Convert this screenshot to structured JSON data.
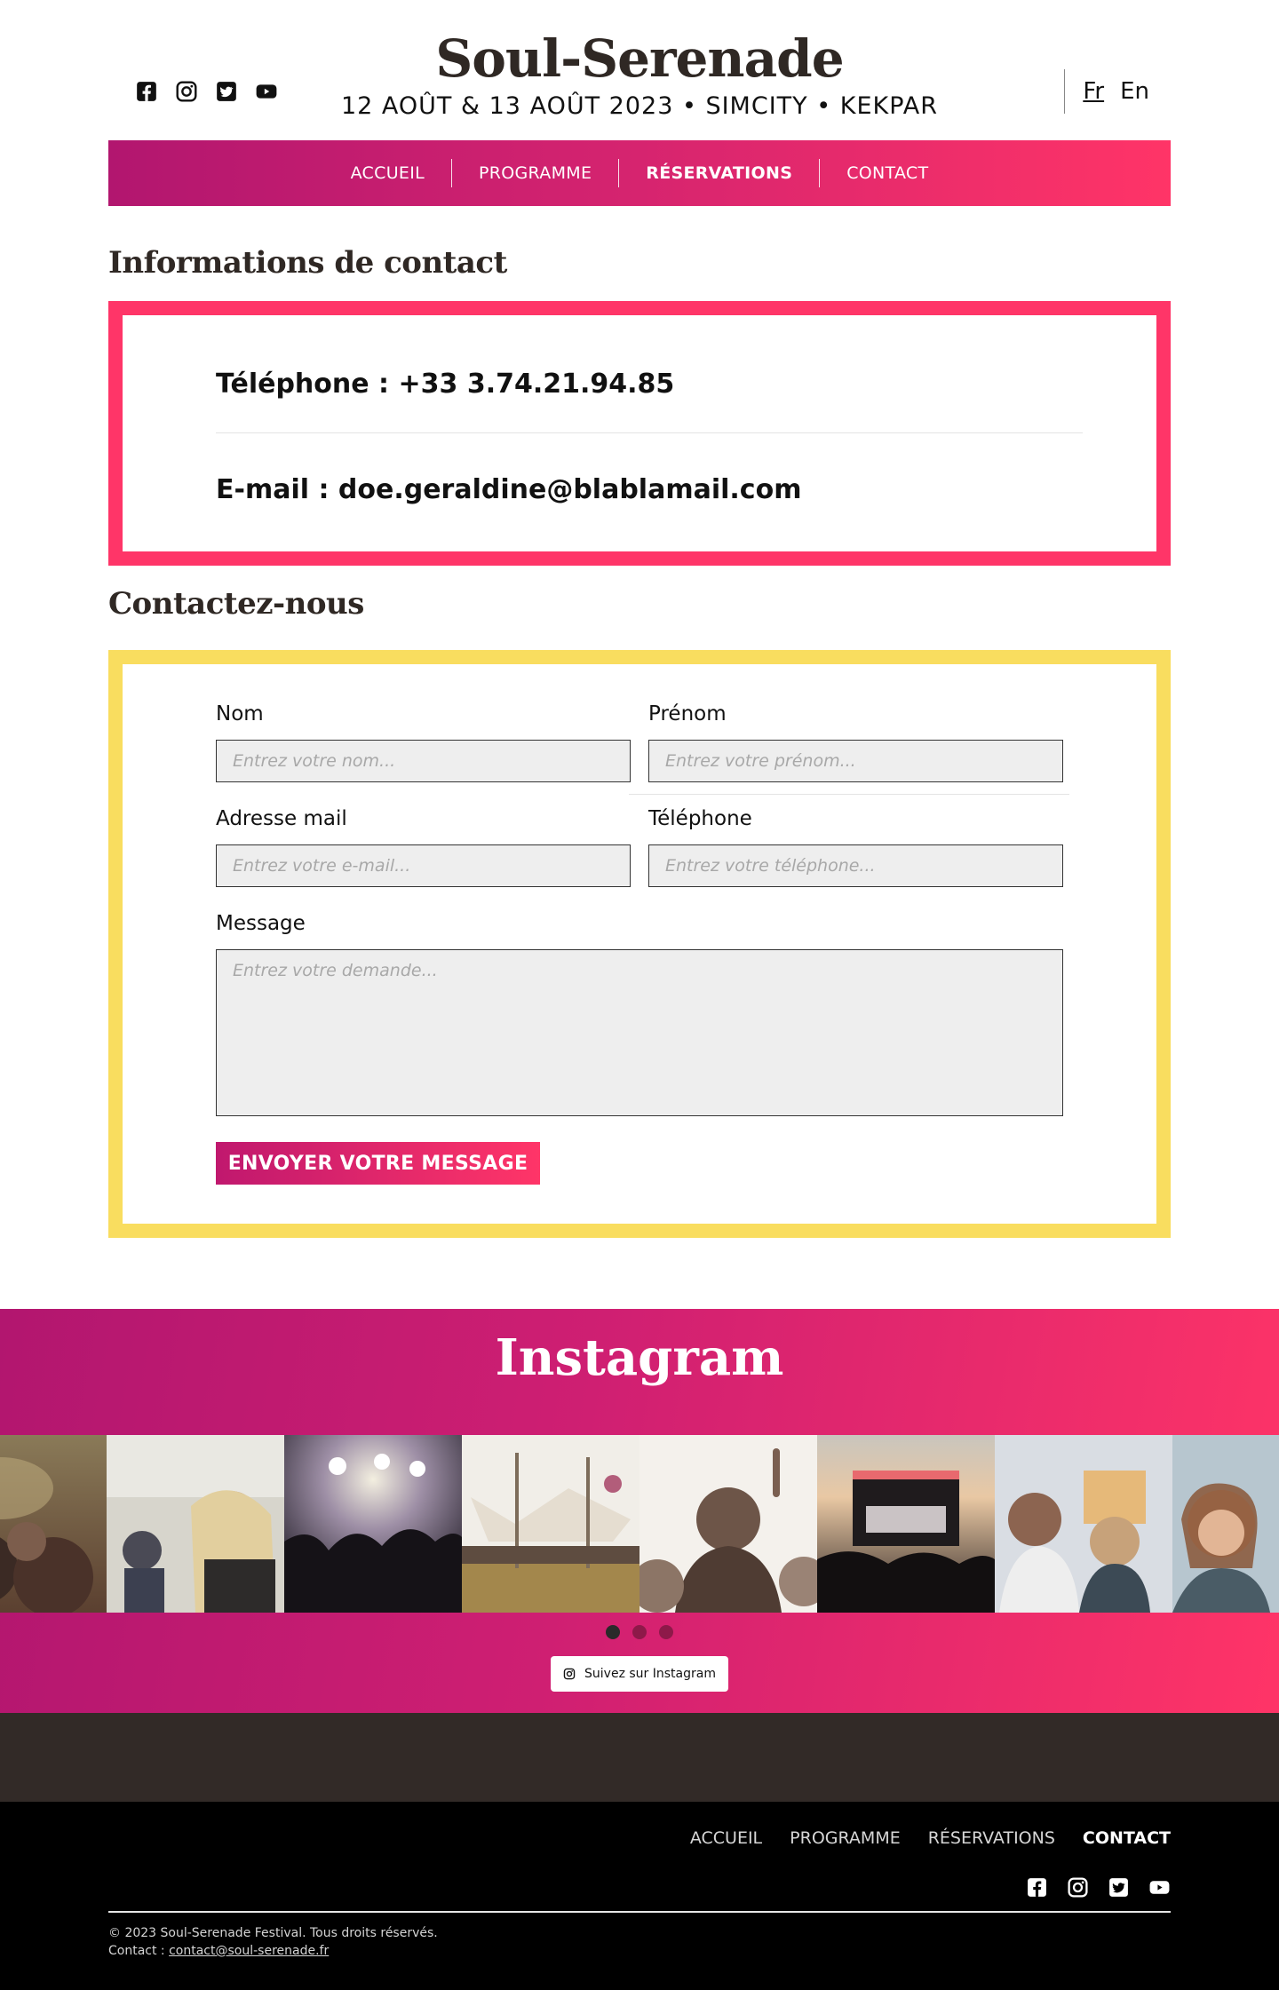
{
  "header": {
    "title": "Soul-Serenade",
    "subtitle": "12 AOÛT & 13 AOÛT 2023 • SIMCITY • KEKPAR",
    "social_icons": [
      "facebook-icon",
      "instagram-icon",
      "twitter-icon",
      "youtube-icon"
    ],
    "languages": [
      {
        "label": "Fr",
        "active": true
      },
      {
        "label": "En",
        "active": false
      }
    ]
  },
  "nav": {
    "items": [
      {
        "label": "ACCUEIL"
      },
      {
        "label": "PROGRAMME"
      },
      {
        "label": "RÉSERVATIONS",
        "active": true
      },
      {
        "label": "CONTACT"
      }
    ]
  },
  "contact_info": {
    "title": "Informations de contact",
    "phone": "Téléphone : +33 3.74.21.94.85",
    "email": "E-mail : doe.geraldine@blablamail.com",
    "border_color": "#ff3568"
  },
  "contact_form": {
    "title": "Contactez-nous",
    "border_color": "#f9dd5f",
    "nom_label": "Nom",
    "nom_placeholder": "Entrez votre nom...",
    "prenom_label": "Prénom",
    "prenom_placeholder": "Entrez votre prénom...",
    "email_label": "Adresse mail",
    "email_placeholder": "Entrez votre e-mail...",
    "tel_label": "Téléphone",
    "tel_placeholder": "Entrez votre téléphone...",
    "message_label": "Message",
    "message_placeholder": "Entrez votre demande...",
    "submit_label": "ENVOYER VOTRE MESSAGE"
  },
  "instagram": {
    "title": "Instagram",
    "follow_label": "Suivez sur Instagram",
    "carousel_dots": 3,
    "active_dot": 0
  },
  "footer": {
    "nav": [
      {
        "label": "ACCUEIL"
      },
      {
        "label": "PROGRAMME"
      },
      {
        "label": "RÉSERVATIONS"
      },
      {
        "label": "CONTACT",
        "active": true
      }
    ],
    "social_icons": [
      "facebook-icon",
      "instagram-icon",
      "twitter-icon",
      "youtube-icon"
    ],
    "copyright": "© 2023 Soul-Serenade Festival. Tous droits réservés.",
    "contact_prefix": "Contact : ",
    "contact_email": "contact@soul-serenade.fr"
  },
  "colors": {
    "brand_dark": "#2f2824",
    "gradient_start": "#b2166f",
    "gradient_end": "#ff3467",
    "footer_band": "#322a27"
  }
}
